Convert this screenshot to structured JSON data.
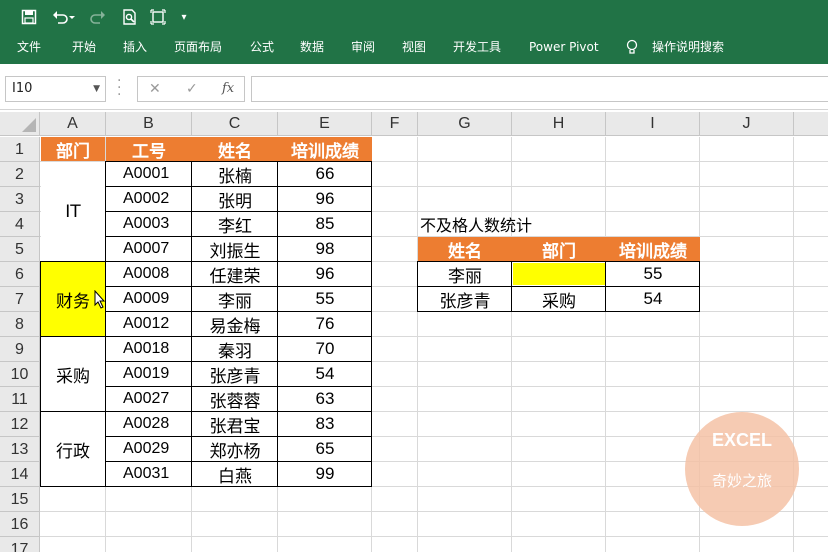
{
  "quick_access": {
    "save_icon": "save-icon",
    "undo_icon": "undo-icon",
    "redo_icon": "redo-icon",
    "preview_icon": "print-preview-icon",
    "touch_icon": "touch-mode-icon",
    "more_icon": "customize-icon"
  },
  "ribbon_tabs": [
    "文件",
    "开始",
    "插入",
    "页面布局",
    "公式",
    "数据",
    "审阅",
    "视图",
    "开发工具",
    "Power Pivot",
    "操作说明搜索"
  ],
  "formula_bar": {
    "name_box": "I10",
    "cancel": "✕",
    "enter": "✓",
    "fx": "fx",
    "formula": ""
  },
  "columns": [
    "A",
    "B",
    "C",
    "E",
    "F",
    "G",
    "H",
    "I",
    "J"
  ],
  "rows": [
    "1",
    "2",
    "3",
    "4",
    "5",
    "6",
    "7",
    "8",
    "9",
    "10",
    "11",
    "12",
    "13",
    "14",
    "15",
    "16",
    "17"
  ],
  "main_table": {
    "headers": [
      "部门",
      "工号",
      "姓名",
      "培训成绩"
    ],
    "departments": [
      "IT",
      "财务",
      "采购",
      "行政"
    ],
    "records": [
      [
        "A0001",
        "张楠",
        "66"
      ],
      [
        "A0002",
        "张明",
        "96"
      ],
      [
        "A0003",
        "李红",
        "85"
      ],
      [
        "A0007",
        "刘振生",
        "98"
      ],
      [
        "A0008",
        "任建荣",
        "96"
      ],
      [
        "A0009",
        "李丽",
        "55"
      ],
      [
        "A0012",
        "易金梅",
        "76"
      ],
      [
        "A0018",
        "秦羽",
        "70"
      ],
      [
        "A0019",
        "张彦青",
        "54"
      ],
      [
        "A0027",
        "张蓉蓉",
        "63"
      ],
      [
        "A0028",
        "张君宝",
        "83"
      ],
      [
        "A0029",
        "郑亦杨",
        "65"
      ],
      [
        "A0031",
        "白燕",
        "99"
      ]
    ]
  },
  "stats_table": {
    "title": "不及格人数统计",
    "headers": [
      "姓名",
      "部门",
      "培训成绩"
    ],
    "rows": [
      [
        "李丽",
        "",
        "55"
      ],
      [
        "张彦青",
        "采购",
        "54"
      ]
    ]
  },
  "watermark": {
    "line1": "EXCEL",
    "line2": "奇妙之旅"
  },
  "colors": {
    "ribbon": "#217346",
    "header_fill": "#ed7d31",
    "highlight": "#ffff00",
    "watermark": "#f5c2a6"
  }
}
